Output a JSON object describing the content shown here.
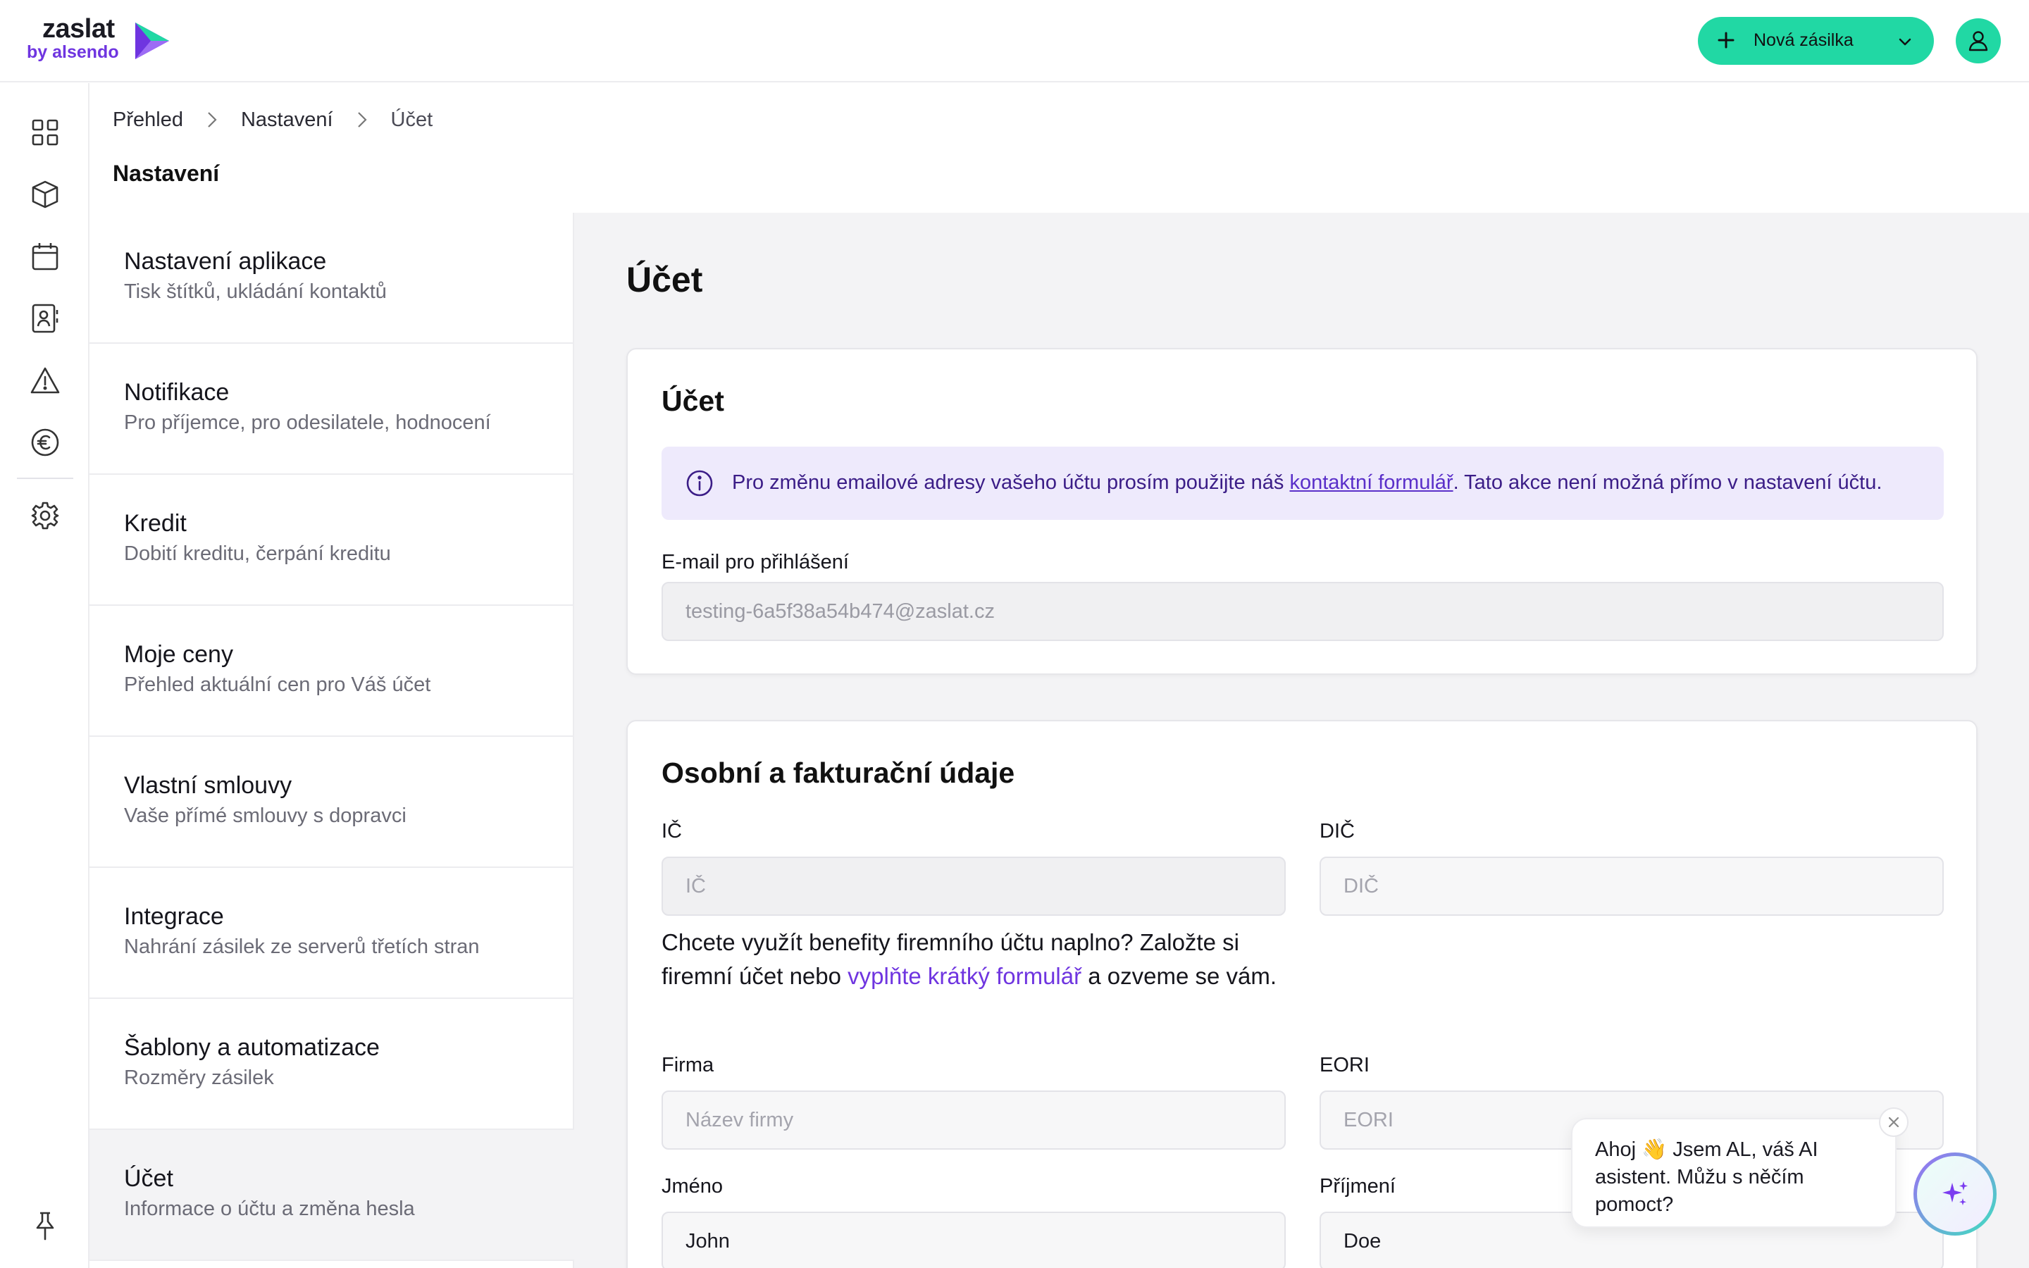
{
  "colors": {
    "brand_green": "#21d8a4",
    "brand_purple": "#6f35e0",
    "info_bg": "#eeeafc",
    "info_text": "#3b1d87"
  },
  "header": {
    "logo_word": "zaslat",
    "logo_sub": "by alsendo",
    "new_shipment_label": "Nová zásilka",
    "avatar_icon": "user-icon"
  },
  "rail": {
    "icons": [
      "grid-icon",
      "package-icon",
      "calendar-icon",
      "contacts-icon",
      "warning-icon",
      "euro-icon",
      "gear-icon",
      "pin-icon"
    ]
  },
  "breadcrumb": {
    "items": [
      "Přehled",
      "Nastavení",
      "Účet"
    ]
  },
  "page_title": "Nastavení",
  "menu": {
    "items": [
      {
        "title": "Nastavení aplikace",
        "subtitle": "Tisk štítků, ukládání kontaktů"
      },
      {
        "title": "Notifikace",
        "subtitle": "Pro příjemce, pro odesilatele, hodnocení"
      },
      {
        "title": "Kredit",
        "subtitle": "Dobití kreditu, čerpání kreditu"
      },
      {
        "title": "Moje ceny",
        "subtitle": "Přehled aktuální cen pro Váš účet"
      },
      {
        "title": "Vlastní smlouvy",
        "subtitle": "Vaše přímé smlouvy s dopravci"
      },
      {
        "title": "Integrace",
        "subtitle": "Nahrání zásilek ze serverů třetích stran"
      },
      {
        "title": "Šablony a automatizace",
        "subtitle": "Rozměry zásilek"
      },
      {
        "title": "Účet",
        "subtitle": "Informace o účtu a změna hesla"
      }
    ],
    "active_index": 7
  },
  "content": {
    "title": "Účet",
    "account_card": {
      "title": "Účet",
      "info_before": "Pro změnu emailové adresy vašeho účtu prosím použijte náš ",
      "info_link": "kontaktní formulář",
      "info_after": ". Tato akce není možná přímo v nastavení účtu.",
      "email_label": "E-mail pro přihlášení",
      "email_value": "testing-6a5f38a54b474@zaslat.cz"
    },
    "billing_card": {
      "title": "Osobní a fakturační údaje",
      "ic_label": "IČ",
      "ic_placeholder": "IČ",
      "dic_label": "DIČ",
      "dic_placeholder": "DIČ",
      "promo_before": "Chcete využít benefity firemního účtu naplno? Založte si firemní účet nebo ",
      "promo_link": "vyplňte krátký formulář",
      "promo_after": " a ozveme se vám.",
      "company_label": "Firma",
      "company_placeholder": "Název firmy",
      "eori_label": "EORI",
      "eori_placeholder": "EORI",
      "first_name_label": "Jméno",
      "first_name_value": "John",
      "last_name_label": "Příjmení",
      "last_name_value": "Doe"
    }
  },
  "chat": {
    "message": "Ahoj 👋 Jsem AL, váš AI asistent. Můžu s něčím pomoct?"
  }
}
